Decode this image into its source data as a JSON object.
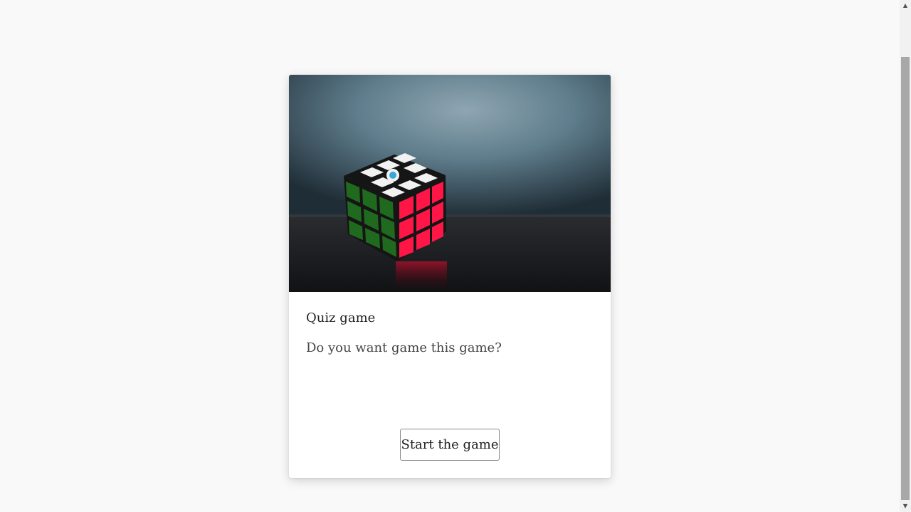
{
  "card": {
    "image_alt": "Rubik's cube on a dark table against a blue-grey wall",
    "title": "Quiz game",
    "text": "Do you want game this game?",
    "button_label": "Start the game"
  },
  "scrollbar": {
    "up_icon": "arrow-up-icon",
    "down_icon": "arrow-down-icon"
  }
}
